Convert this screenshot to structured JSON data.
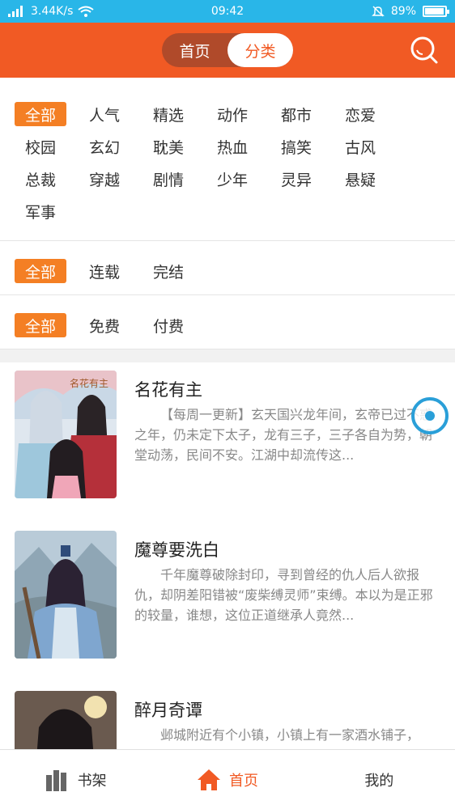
{
  "status_bar": {
    "speed": "3.44K/s",
    "time": "09:42",
    "battery": "89%",
    "battery_level": 0.89
  },
  "header": {
    "tabs": [
      {
        "label": "首页"
      },
      {
        "label": "分类"
      }
    ],
    "active_tab": "分类"
  },
  "filters": {
    "categories": [
      "全部",
      "人气",
      "精选",
      "动作",
      "都市",
      "恋爱",
      "校园",
      "玄幻",
      "耽美",
      "热血",
      "搞笑",
      "古风",
      "总裁",
      "穿越",
      "剧情",
      "少年",
      "灵异",
      "悬疑",
      "军事"
    ],
    "status": [
      "全部",
      "连载",
      "完结"
    ],
    "price": [
      "全部",
      "免费",
      "付费"
    ]
  },
  "books": [
    {
      "title": "名花有主",
      "description": "【每周一更新】玄天国兴龙年间，玄帝已过不惑之年，仍未定下太子，龙有三子，三子各自为势，朝堂动荡，民间不安。江湖中却流传这..."
    },
    {
      "title": "魔尊要洗白",
      "description": "千年魔尊破除封印，寻到曾经的仇人后人欲报仇，却阴差阳错被“废柴缚灵师”束缚。本以为是正邪的较量，谁想，这位正道继承人竟然..."
    },
    {
      "title": "醉月奇谭",
      "description": "邺城附近有个小镇，小镇上有一家酒水铺子，"
    }
  ],
  "tabbar": {
    "items": [
      {
        "label": "书架"
      },
      {
        "label": "首页"
      },
      {
        "label": "我的"
      }
    ]
  },
  "colors": {
    "header": "#f15a24",
    "status_bar": "#29b6e8",
    "chip_active": "#f47f24"
  }
}
